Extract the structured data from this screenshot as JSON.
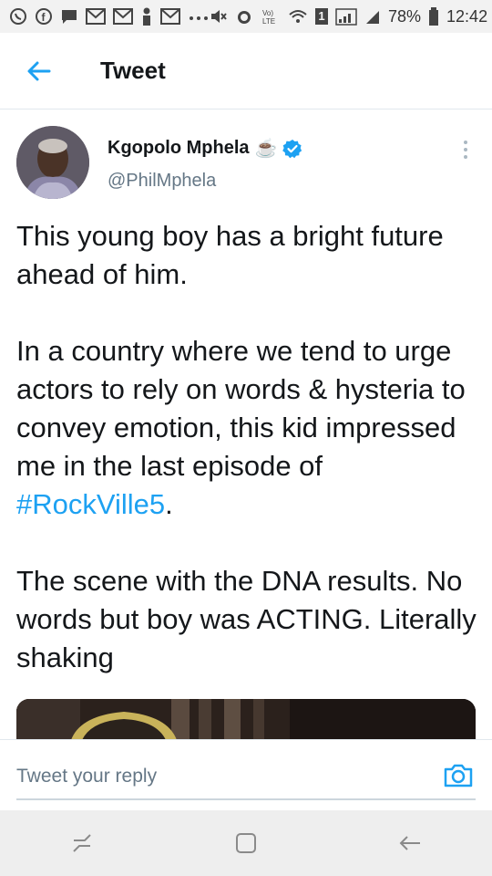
{
  "status_bar": {
    "battery": "78%",
    "time": "12:42",
    "notification_icons": [
      "whatsapp-icon",
      "facebook-icon",
      "message-icon",
      "gmail-icon",
      "gmail-icon",
      "person-icon",
      "gmail-icon",
      "more-dots-icon"
    ],
    "system_icons": [
      "mute-icon",
      "alarm-icon",
      "volte-icon",
      "wifi-icon",
      "sim-icon",
      "signal-icon",
      "signal-icon",
      "battery-icon"
    ],
    "volte_text": "Vo)\nLTE",
    "sim_number": "1"
  },
  "app_bar": {
    "title": "Tweet",
    "back_icon": "back-arrow-icon",
    "accent": "#1da1f2"
  },
  "tweet": {
    "display_name": "Kgopolo Mphela",
    "emoji": "☕",
    "verified_icon": "verified-badge-icon",
    "handle": "@PhilMphela",
    "paragraphs": {
      "p1": "This young boy has a bright future ahead of him.",
      "p2_before": "In a country where we tend to urge actors to rely on words & hysteria to convey emotion, this kid impressed me in the last episode of ",
      "p2_hashtag": "#RockVille5",
      "p2_after": ".",
      "p3": "The scene with the DNA results. No words but boy was ACTING. Literally shaking"
    }
  },
  "reply": {
    "placeholder": "Tweet your reply",
    "camera_icon": "camera-icon"
  },
  "nav_bar": {
    "icons": [
      "recents-icon",
      "home-icon",
      "back-icon"
    ]
  }
}
